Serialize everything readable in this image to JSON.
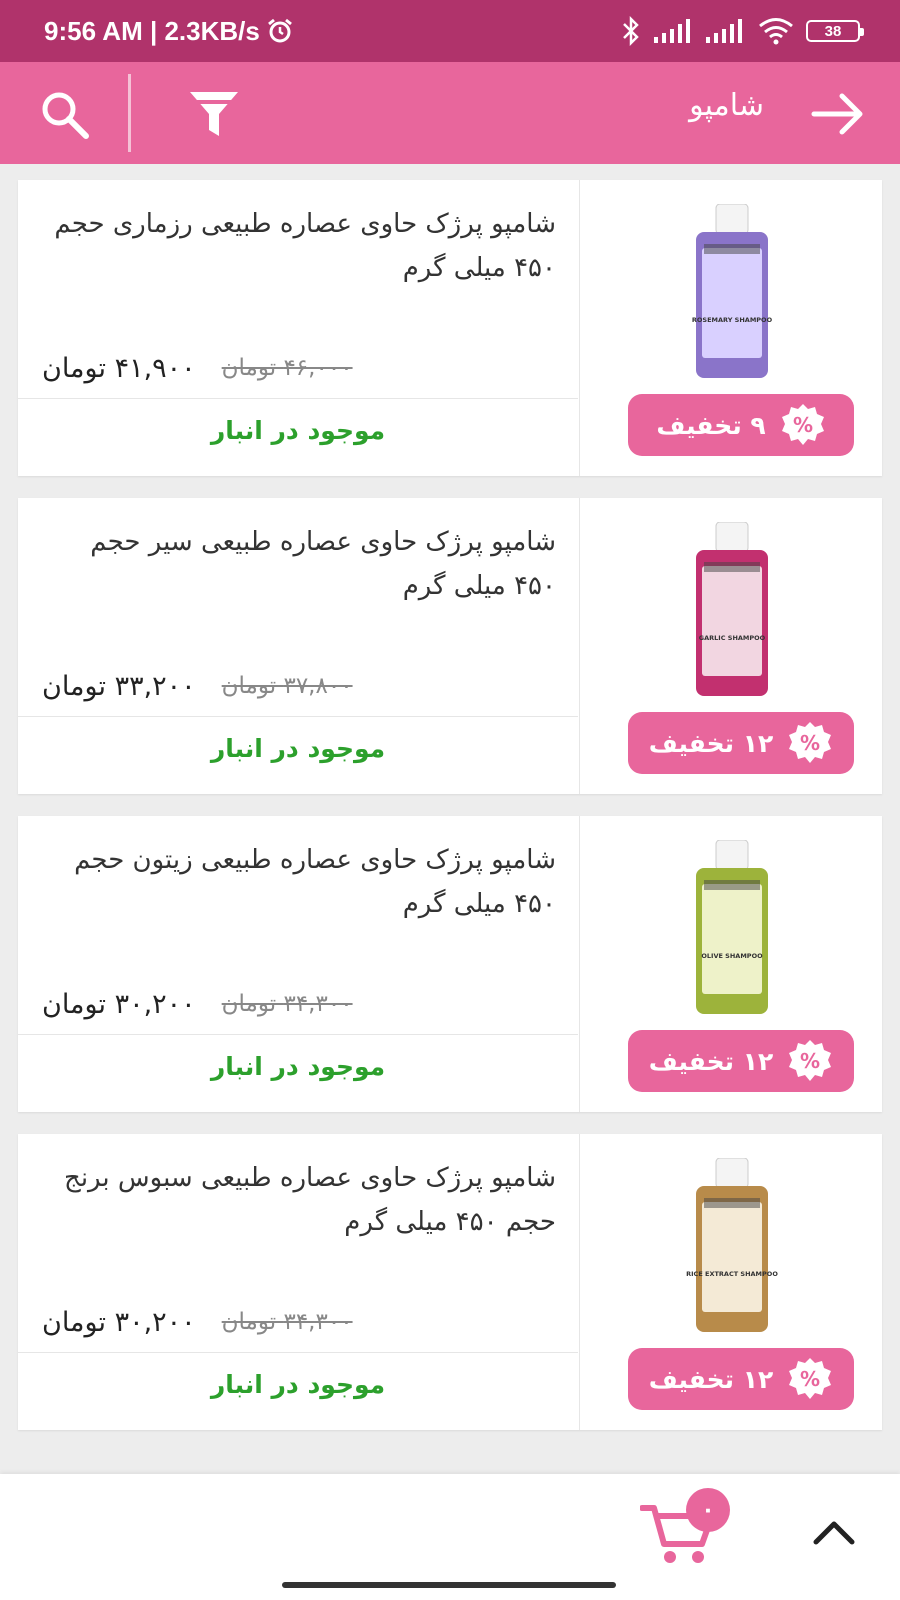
{
  "status_bar": {
    "time": "9:56 AM | 2.3KB/s",
    "battery": "38"
  },
  "toolbar": {
    "title": "شامپو"
  },
  "colors": {
    "status_bar": "#b0336b",
    "toolbar": "#e8669c",
    "in_stock": "#2ca02c",
    "badge": "#e8669c"
  },
  "products": [
    {
      "title": "شامپو پرژک حاوی عصاره طبیعی رزماری حجم ۴۵۰ میلی گرم",
      "price": "۴۱,۹۰۰ تومان",
      "old_price": "۴۶,۰۰۰ تومان",
      "stock": "موجود در انبار",
      "discount": "۹ تخفیف",
      "image_label": "ROSEMARY SHAMPOO",
      "image_colors": [
        "#8a74c9",
        "#d9d0ff"
      ]
    },
    {
      "title": "شامپو پرژک حاوی عصاره طبیعی سیر حجم ۴۵۰ میلی گرم",
      "price": "۳۳,۲۰۰ تومان",
      "old_price": "۳۷,۸۰۰ تومان",
      "stock": "موجود در انبار",
      "discount": "۱۲ تخفیف",
      "image_label": "GARLIC SHAMPOO",
      "image_colors": [
        "#c2306f",
        "#f2d6e1"
      ]
    },
    {
      "title": "شامپو پرژک حاوی عصاره طبیعی زیتون حجم ۴۵۰ میلی گرم",
      "price": "۳۰,۲۰۰ تومان",
      "old_price": "۳۴,۳۰۰ تومان",
      "stock": "موجود در انبار",
      "discount": "۱۲ تخفیف",
      "image_label": "OLIVE SHAMPOO",
      "image_colors": [
        "#9db33b",
        "#eef2c9"
      ]
    },
    {
      "title": "شامپو پرژک حاوی عصاره طبیعی سبوس برنج حجم ۴۵۰ میلی گرم",
      "price": "۳۰,۲۰۰ تومان",
      "old_price": "۳۴,۳۰۰ تومان",
      "stock": "موجود در انبار",
      "discount": "۱۲ تخفیف",
      "image_label": "RICE EXTRACT SHAMPOO",
      "image_colors": [
        "#b88b4a",
        "#f4ead6"
      ]
    }
  ],
  "bottom_bar": {
    "cart_count": "۰"
  }
}
